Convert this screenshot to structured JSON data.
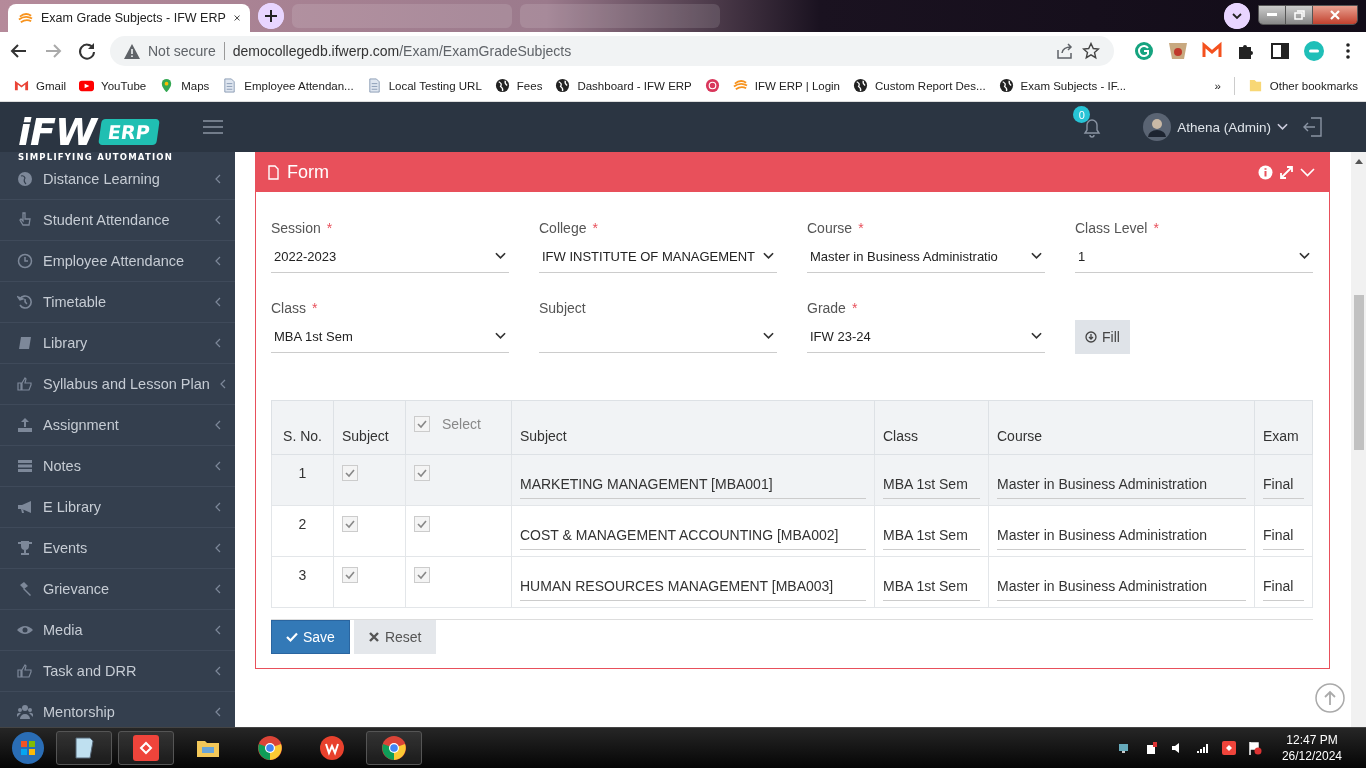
{
  "browser": {
    "tab_title": "Exam Grade Subjects - IFW ERP",
    "security": "Not secure",
    "url_host": "democollegedb.ifwerp.com",
    "url_path": "/Exam/ExamGradeSubjects",
    "bookmarks": [
      {
        "label": "Gmail",
        "kind": "mail"
      },
      {
        "label": "YouTube",
        "kind": "video"
      },
      {
        "label": "Maps",
        "kind": "pin"
      },
      {
        "label": "Employee Attendan...",
        "kind": "page"
      },
      {
        "label": "Local Testing URL",
        "kind": "page"
      },
      {
        "label": "Fees",
        "kind": "globe"
      },
      {
        "label": "Dashboard - IFW ERP",
        "kind": "globe"
      },
      {
        "kind": "target"
      },
      {
        "label": "IFW ERP | Login",
        "kind": "swirl"
      },
      {
        "label": "Custom Report Des...",
        "kind": "globe"
      },
      {
        "label": "Exam Subjects - IF...",
        "kind": "globe"
      }
    ],
    "more": "»",
    "other_bookmarks": "Other bookmarks"
  },
  "header": {
    "logo_text": "iFW",
    "logo_badge": "ERP",
    "logo_tagline": "SIMPLIFYING AUTOMATION",
    "notification_count": "0",
    "user": "Athena (Admin)"
  },
  "sidebar": {
    "items": [
      {
        "label": "Distance Learning",
        "kind": "globe"
      },
      {
        "label": "Student Attendance",
        "kind": "hand"
      },
      {
        "label": "Employee Attendance",
        "kind": "clock"
      },
      {
        "label": "Timetable",
        "kind": "history"
      },
      {
        "label": "Library",
        "kind": "book"
      },
      {
        "label": "Syllabus and Lesson Plan",
        "kind": "thumb"
      },
      {
        "label": "Assignment",
        "kind": "upload"
      },
      {
        "label": "Notes",
        "kind": "list"
      },
      {
        "label": "E Library",
        "kind": "megaphone"
      },
      {
        "label": "Events",
        "kind": "trophy"
      },
      {
        "label": "Grievance",
        "kind": "gavel"
      },
      {
        "label": "Media",
        "kind": "eye"
      },
      {
        "label": "Task and DRR",
        "kind": "thumb"
      },
      {
        "label": "Mentorship",
        "kind": "users"
      }
    ]
  },
  "panel": {
    "title": "Form",
    "fields": [
      {
        "label": "Session",
        "required_mark": "*",
        "value": "2022-2023"
      },
      {
        "label": "College",
        "required_mark": "*",
        "value": "IFW INSTITUTE OF MANAGEMENT"
      },
      {
        "label": "Course",
        "required_mark": "*",
        "value": "Master in Business Administratio"
      },
      {
        "label": "Class Level",
        "required_mark": "*",
        "value": "1"
      },
      {
        "label": "Class",
        "required_mark": "*",
        "value": "MBA 1st Sem"
      },
      {
        "label": "Subject"
      },
      {
        "label": "Grade",
        "required_mark": "*",
        "value": "IFW 23-24"
      }
    ],
    "fill_button": "Fill"
  },
  "table": {
    "columns": [
      "S. No.",
      "Subject",
      "Subject",
      "Class",
      "Course",
      "Exam"
    ],
    "select_all": {
      "label": "Select",
      "checked": true
    },
    "rows": [
      {
        "sno": "1",
        "subject_checked": true,
        "select_checked": true,
        "subject": "MARKETING MANAGEMENT [MBA001]",
        "class": "MBA 1st Sem",
        "course": "Master in Business Administration",
        "exam": "Final",
        "highlighted": true
      },
      {
        "sno": "2",
        "subject_checked": true,
        "select_checked": true,
        "subject": "COST & MANAGEMENT ACCOUNTING [MBA002]",
        "class": "MBA 1st Sem",
        "course": "Master in Business Administration",
        "exam": "Final",
        "highlighted": false
      },
      {
        "sno": "3",
        "subject_checked": true,
        "select_checked": true,
        "subject": "HUMAN RESOURCES MANAGEMENT [MBA003]",
        "class": "MBA 1st Sem",
        "course": "Master in Business Administration",
        "exam": "Final",
        "highlighted": false
      }
    ]
  },
  "buttons": [
    {
      "kind": "save",
      "label": "Save"
    },
    {
      "kind": "reset",
      "label": "Reset"
    }
  ],
  "taskbar": {
    "time": "12:47 PM",
    "date": "26/12/2024"
  }
}
